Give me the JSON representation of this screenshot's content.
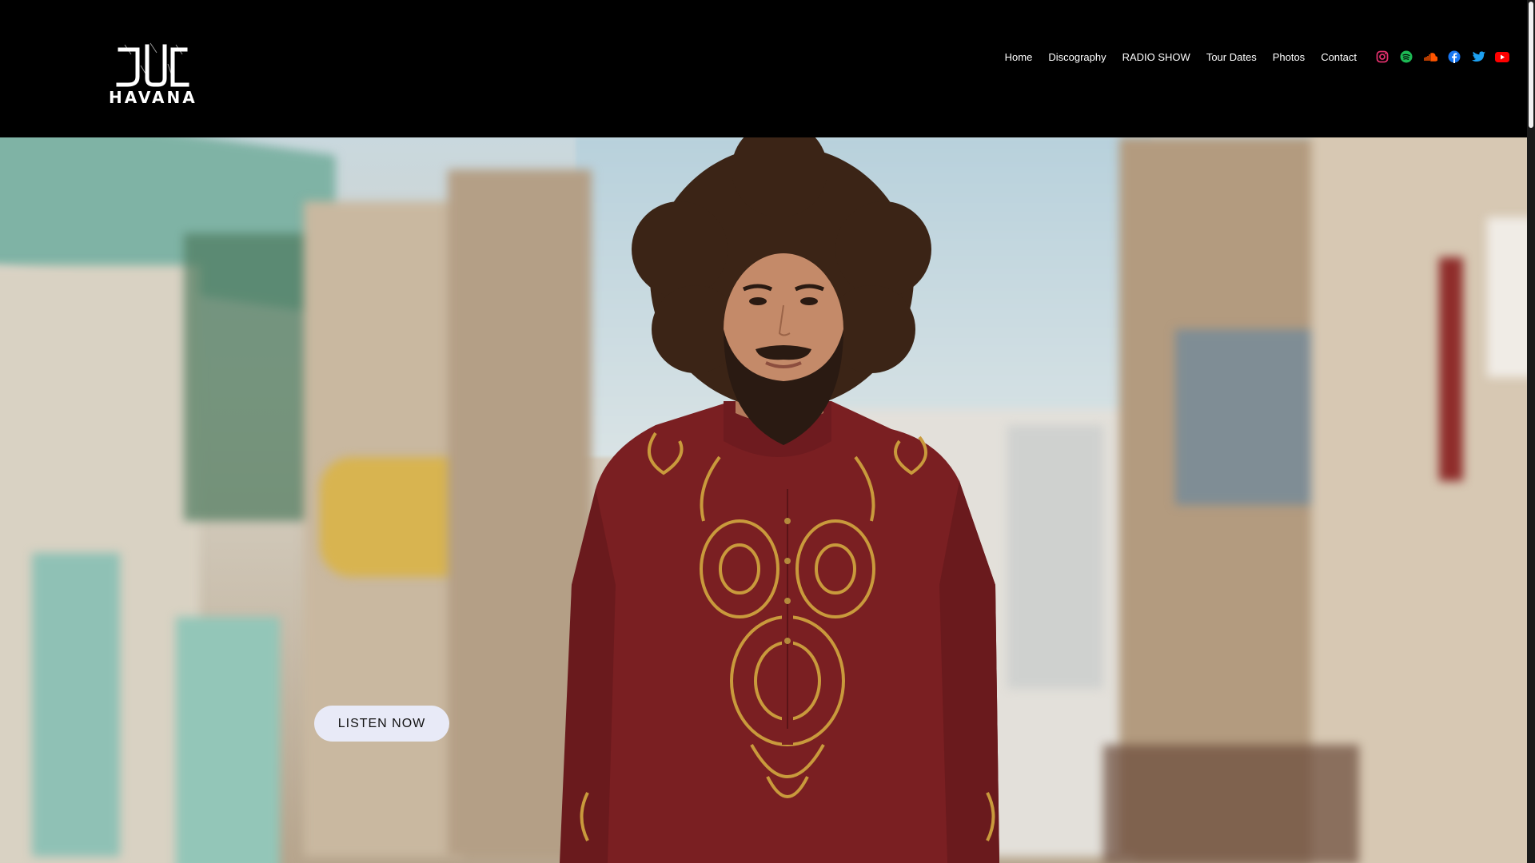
{
  "brand": {
    "logo_text": "HAVANA"
  },
  "nav": {
    "items": [
      {
        "label": "Home"
      },
      {
        "label": "Discography"
      },
      {
        "label": "RADIO SHOW"
      },
      {
        "label": "Tour Dates"
      },
      {
        "label": "Photos"
      },
      {
        "label": "Contact"
      }
    ]
  },
  "socials": [
    {
      "icon": "instagram-icon",
      "color": "#e1306c"
    },
    {
      "icon": "spotify-icon",
      "color": "#1db954"
    },
    {
      "icon": "soundcloud-icon",
      "color": "#ff5500"
    },
    {
      "icon": "facebook-icon",
      "color": "#1877f2"
    },
    {
      "icon": "twitter-icon",
      "color": "#1da1f2"
    },
    {
      "icon": "youtube-icon",
      "color": "#ff0000"
    }
  ],
  "hero": {
    "cta_label": "LISTEN NOW"
  },
  "colors": {
    "header_bg": "#000000",
    "button_bg": "#e8eaf7",
    "shirt": "#7a1f22",
    "embroidery": "#c99a3c"
  }
}
